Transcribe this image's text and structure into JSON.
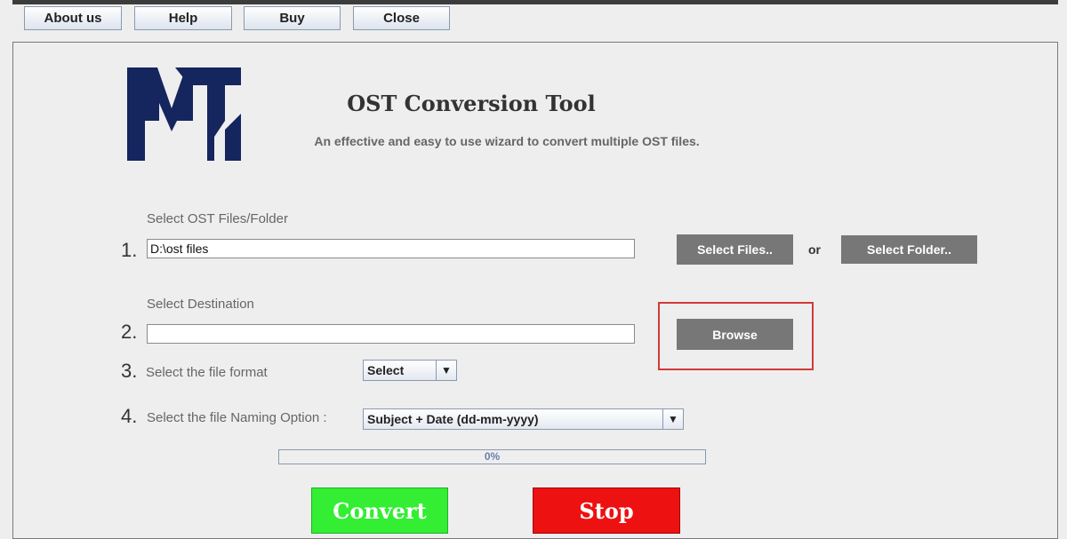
{
  "menu": {
    "about_label": "About us",
    "help_label": "Help",
    "buy_label": "Buy",
    "close_label": "Close"
  },
  "header": {
    "title": "OST Conversion Tool",
    "subtitle": "An effective and easy to use wizard to convert multiple OST files."
  },
  "step1": {
    "number": "1.",
    "label": "Select OST Files/Folder",
    "value": "D:\\ost files",
    "select_files_label": "Select Files..",
    "or_label": "or",
    "select_folder_label": "Select Folder.."
  },
  "step2": {
    "number": "2.",
    "label": "Select Destination",
    "value": "",
    "browse_label": "Browse"
  },
  "step3": {
    "number": "3.",
    "label": "Select the file format",
    "selected": "Select"
  },
  "step4": {
    "number": "4.",
    "label": "Select the file Naming Option :",
    "selected": "Subject + Date (dd-mm-yyyy)"
  },
  "progress": {
    "text": "0%",
    "value": 0
  },
  "actions": {
    "convert_label": "Convert",
    "stop_label": "Stop"
  },
  "colors": {
    "logo": "#15255e",
    "convert": "#33ee33",
    "stop": "#ee1111",
    "highlight": "#d23a3a",
    "button_gray": "#777777"
  }
}
